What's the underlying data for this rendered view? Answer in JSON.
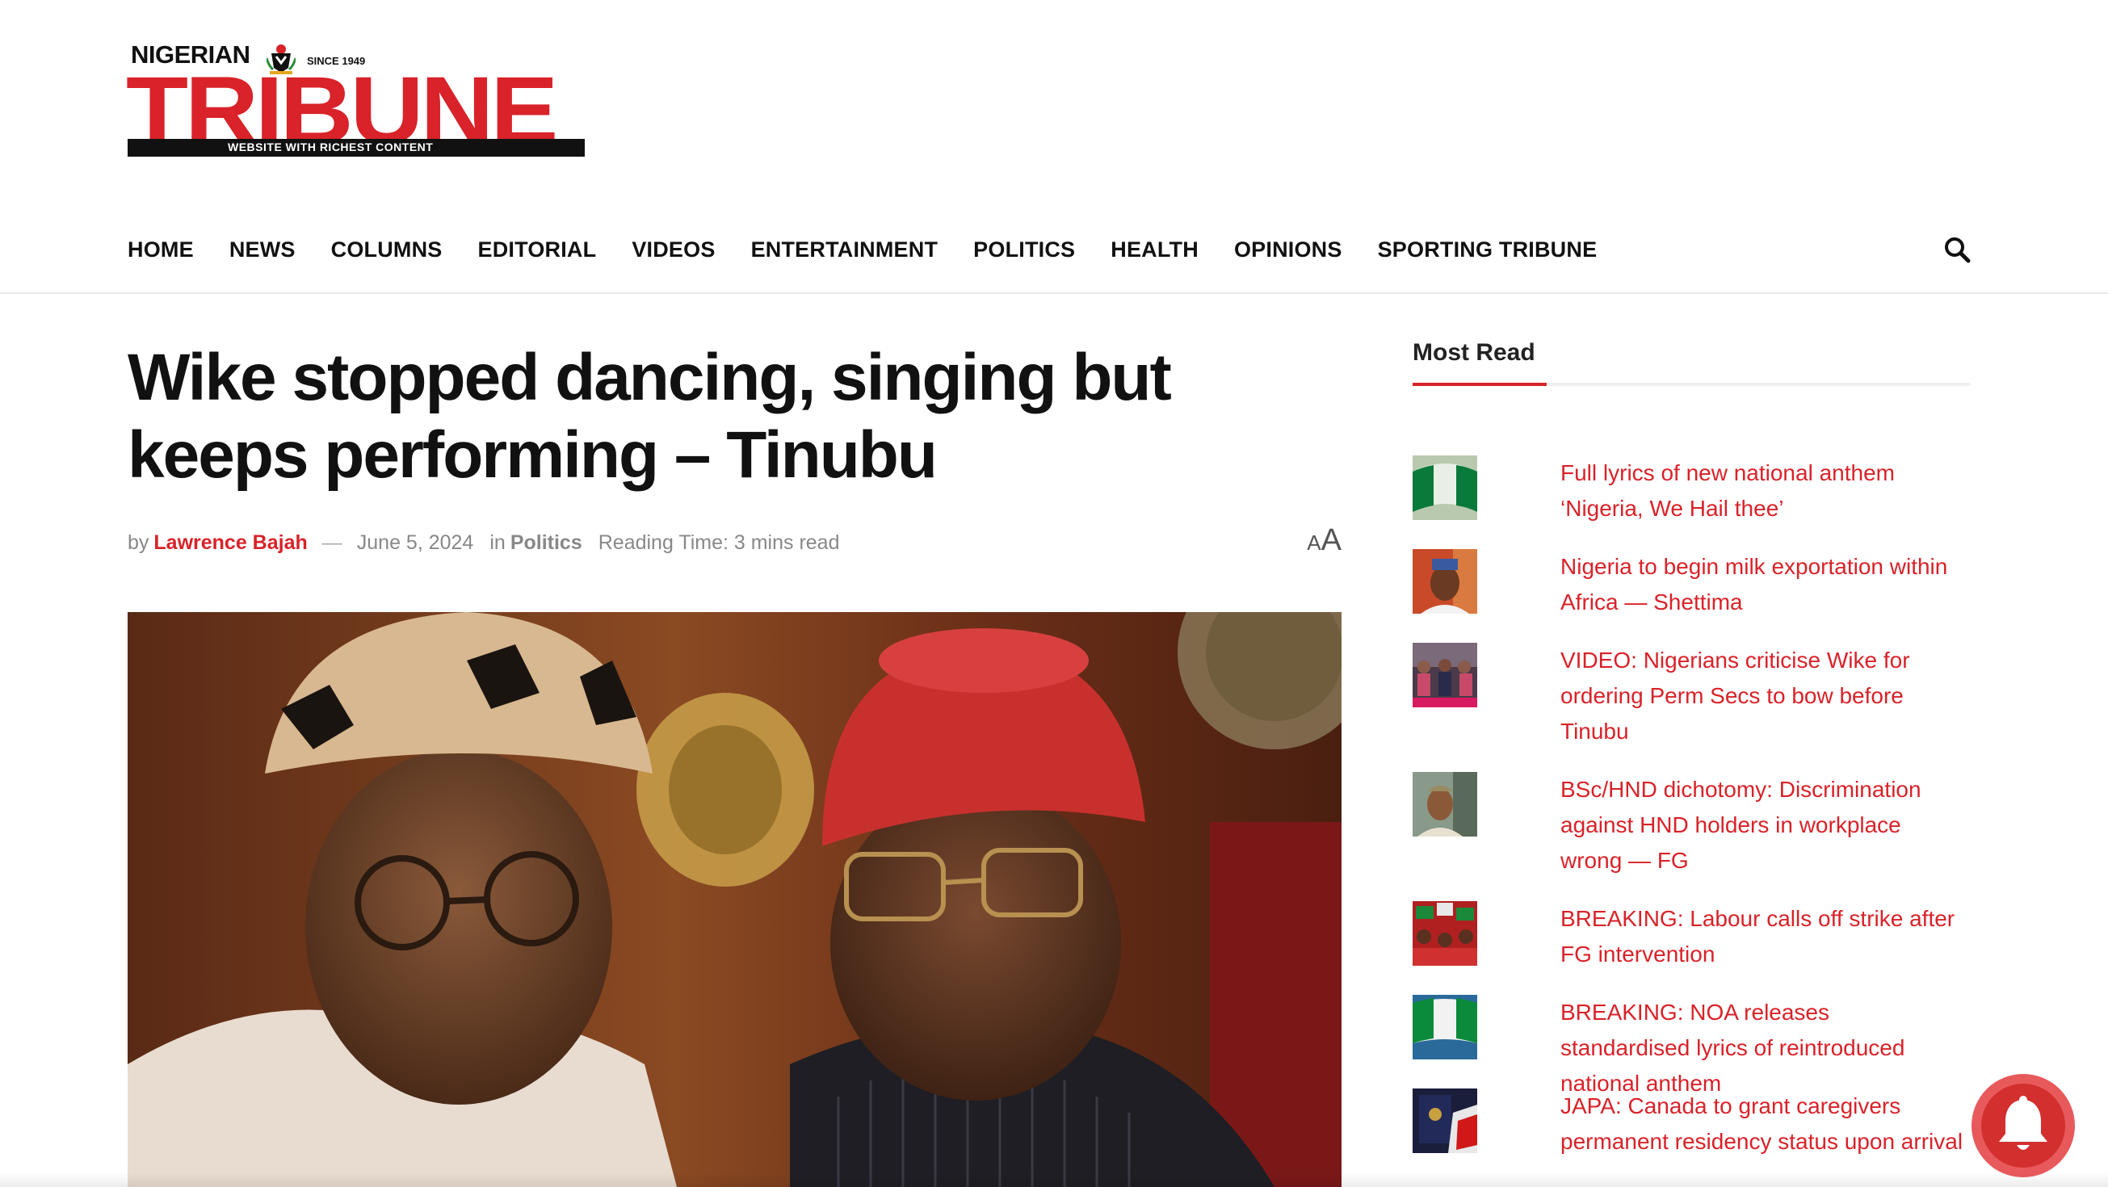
{
  "logo": {
    "top_text": "NIGERIAN",
    "since": "SINCE 1949",
    "main_text": "TRIBUNE",
    "tagline": "WEBSITE WITH RICHEST CONTENT",
    "brand_color": "#d92229"
  },
  "nav": {
    "items": [
      {
        "label": "HOME"
      },
      {
        "label": "NEWS"
      },
      {
        "label": "COLUMNS"
      },
      {
        "label": "EDITORIAL"
      },
      {
        "label": "VIDEOS"
      },
      {
        "label": "ENTERTAINMENT"
      },
      {
        "label": "POLITICS"
      },
      {
        "label": "HEALTH"
      },
      {
        "label": "OPINIONS"
      },
      {
        "label": "SPORTING TRIBUNE"
      }
    ],
    "search_icon": "search-icon"
  },
  "article": {
    "title": "Wike stopped dancing, singing but keeps performing – Tinubu",
    "by": "by",
    "author": "Lawrence Bajah",
    "dash": "—",
    "date": "June 5, 2024",
    "in": "in",
    "category": "Politics",
    "reading_time": "Reading Time: 3 mins read",
    "font_toggle_small": "A",
    "font_toggle_big": "A",
    "hero_image": "photo of Tinubu and Wike"
  },
  "sidebar": {
    "title": "Most Read",
    "items": [
      {
        "text": "Full lyrics of new national anthem ‘Nigeria, We Hail thee’",
        "thumb": "nigeria-flag"
      },
      {
        "text": "Nigeria to begin milk exportation within Africa — Shettima",
        "thumb": "portrait"
      },
      {
        "text": "VIDEO: Nigerians criticise Wike for ordering Perm Secs to bow before Tinubu",
        "thumb": "video-still"
      },
      {
        "text": "BSc/HND dichotomy: Discrimination against HND holders in workplace wrong — FG",
        "thumb": "portrait"
      },
      {
        "text": "BREAKING: Labour calls off strike after FG intervention",
        "thumb": "crowd"
      },
      {
        "text": "BREAKING: NOA releases standardised lyrics of reintroduced national anthem",
        "thumb": "nigeria-flag"
      },
      {
        "text": "JAPA: Canada to grant caregivers permanent residency status upon arrival",
        "thumb": "passport"
      }
    ]
  },
  "notification": {
    "icon": "bell-icon",
    "color": "#d32f2f"
  }
}
